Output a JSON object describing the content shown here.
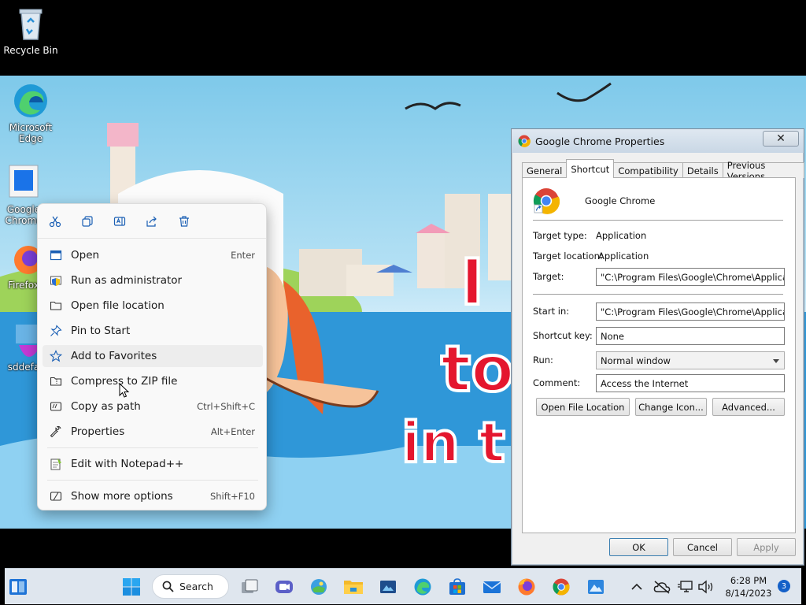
{
  "desktop": {
    "icons": [
      {
        "label": "Recycle Bin"
      },
      {
        "label": "Microsoft Edge"
      },
      {
        "label": "Google Chrome"
      },
      {
        "label": "Firefox"
      },
      {
        "label": "sddefa"
      }
    ]
  },
  "context_menu": {
    "quick_actions": [
      "cut-icon",
      "copy-icon",
      "rename-icon",
      "share-icon",
      "delete-icon"
    ],
    "items": [
      {
        "label": "Open",
        "shortcut": "Enter",
        "icon": "open-icon"
      },
      {
        "label": "Run as administrator",
        "shortcut": "",
        "icon": "shield-icon"
      },
      {
        "label": "Open file location",
        "shortcut": "",
        "icon": "folder-icon"
      },
      {
        "label": "Pin to Start",
        "shortcut": "",
        "icon": "pin-icon"
      },
      {
        "label": "Add to Favorites",
        "shortcut": "",
        "icon": "star-icon"
      },
      {
        "label": "Compress to ZIP file",
        "shortcut": "",
        "icon": "zip-icon"
      },
      {
        "label": "Copy as path",
        "shortcut": "Ctrl+Shift+C",
        "icon": "path-icon"
      },
      {
        "label": "Properties",
        "shortcut": "Alt+Enter",
        "icon": "wrench-icon"
      },
      {
        "label": "Edit with Notepad++",
        "shortcut": "",
        "icon": "notepad-icon"
      },
      {
        "label": "Show more options",
        "shortcut": "Shift+F10",
        "icon": "more-options-icon"
      }
    ]
  },
  "dialog": {
    "title": "Google Chrome Properties",
    "close": "✕",
    "tabs": [
      "General",
      "Shortcut",
      "Compatibility",
      "Details",
      "Previous Versions"
    ],
    "active_tab": "Shortcut",
    "app_name": "Google Chrome",
    "target_type_label": "Target type:",
    "target_type_value": "Application",
    "target_location_label": "Target location:",
    "target_location_value": "Application",
    "target_label": "Target:",
    "target_value": "\"C:\\Program Files\\Google\\Chrome\\Application\\chrome.exe\"",
    "start_in_label": "Start in:",
    "start_in_value": "\"C:\\Program Files\\Google\\Chrome\\Application\"",
    "shortcut_key_label": "Shortcut key:",
    "shortcut_key_value": "None",
    "run_label": "Run:",
    "run_value": "Normal window",
    "comment_label": "Comment:",
    "comment_value": "Access the Internet",
    "open_file_location": "Open File Location",
    "change_icon": "Change Icon...",
    "advanced": "Advanced...",
    "ok": "OK",
    "cancel": "Cancel",
    "apply": "Apply"
  },
  "taskbar": {
    "search_label": "Search",
    "time": "6:28 PM",
    "date": "8/14/2023",
    "notification_count": "3"
  },
  "colors": {
    "accent": "#0067c0",
    "menu_bg": "#f9f9f9",
    "dialog_bg": "#f0f0f0",
    "taskbar_bg": "#dfe6ee"
  }
}
